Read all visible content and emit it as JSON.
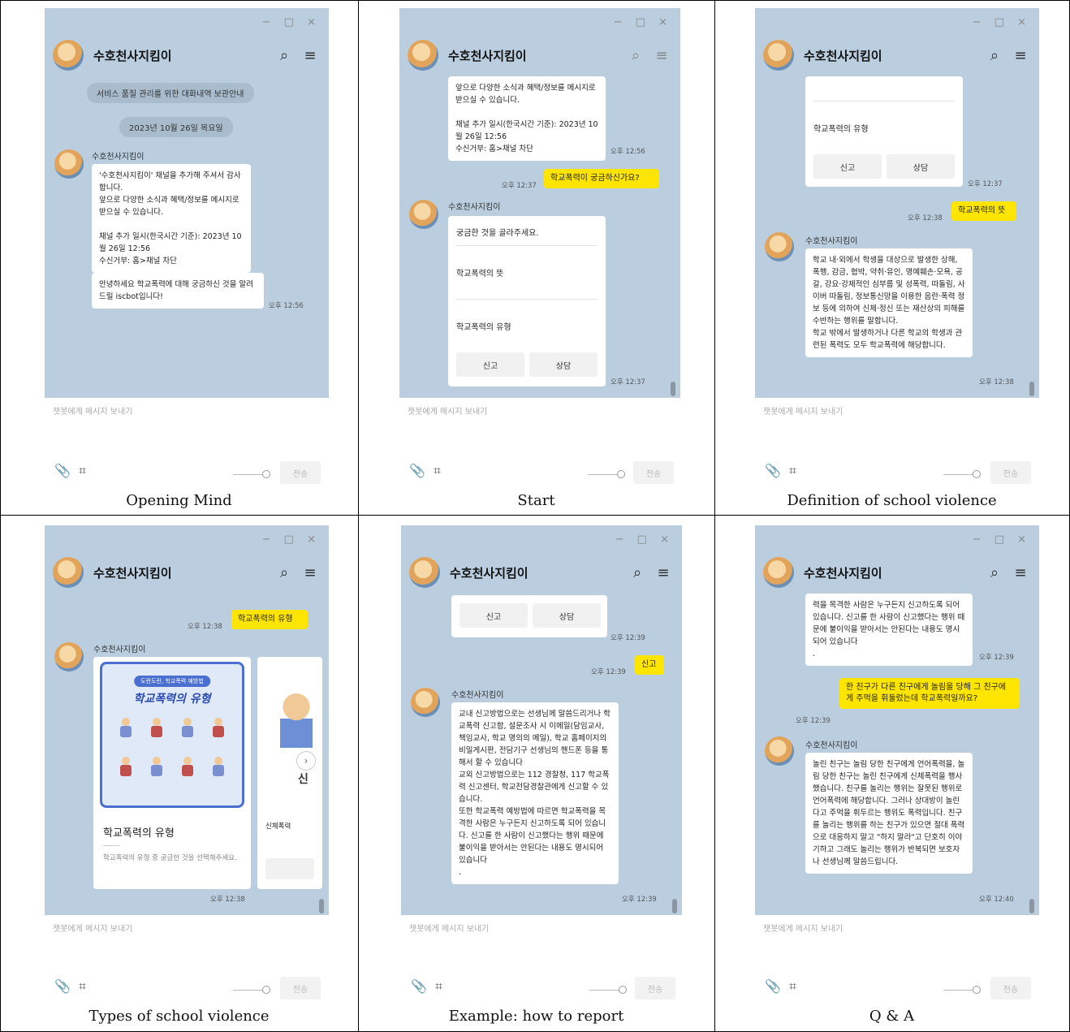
{
  "window": {
    "controls": "− □ ×",
    "bot_name": "수호천사지킴이",
    "input_placeholder": "챗봇에게 메시지 보내기",
    "send_label": "전송"
  },
  "colors": {
    "chat_bg": "#bacee0",
    "user_bubble": "#fee500",
    "bot_bubble": "#ffffff"
  },
  "captions": [
    "Opening Mind",
    "Start",
    "Definition of school violence",
    "Types of school violence",
    "Example: how to report",
    "Q & A"
  ],
  "panel1": {
    "notice": "서비스 품질 관리를 위한 대화내역 보관안내",
    "date": "2023년 10월 26일 목요일",
    "sender": "수호천사지킴이",
    "msg1": "'수호천사지킴이' 채널을 추가해 주셔서 감사합니다.\n앞으로 다양한 소식과 혜택/정보를 메시지로 받으실 수 있습니다.\n\n채널 추가 일시(한국시간 기준): 2023년 10월 26일 12:56\n수신거부: 홈>채널 차단",
    "msg2": "안녕하세요 학교폭력에 대해 궁금하신 것을 알려드릴 iscbot입니다!",
    "time": "오후 12:56"
  },
  "panel2": {
    "msg_top": "앞으로 다양한 소식과 혜택/정보를 메시지로 받으실 수 있습니다.\n\n채널 추가 일시(한국시간 기준): 2023년 10월 26일 12:56\n수신거부: 홈>채널 차단",
    "time1": "오후 12:56",
    "user_msg": "학교폭력이 궁금하신가요?",
    "time2": "오후 12:37",
    "sender": "수호천사지킴이",
    "card_header": "궁금한 것을 골라주세요.",
    "item1": "학교폭력의 뜻",
    "item2": "학교폭력의 유형",
    "btn_report": "신고",
    "btn_counsel": "상담",
    "time3": "오후 12:37"
  },
  "panel3": {
    "item": "학교폭력의 유형",
    "btn_report": "신고",
    "btn_counsel": "상담",
    "time1": "오후 12:37",
    "user_msg": "학교폭력의 뜻",
    "time2": "오후 12:38",
    "sender": "수호천사지킴이",
    "answer": "학교 내·외에서 학생을 대상으로 발생한 상해, 폭행, 감금, 협박, 약취·유인, 명예훼손·모욕, 공갈, 강요·강제적인 심부름 및 성폭력, 따돌림, 사이버 따돌림, 정보통신망을 이용한 음란·폭력 정보 등에 의하여 신체·정신 또는 재산상의 피해를 수반하는 행위를 말합니다.\n학교 밖에서 발생하거나 다른 학교의 학생과 관련된 폭력도 모두 학교폭력에 해당합니다.",
    "time3": "오후 12:38"
  },
  "panel4": {
    "time1": "오후 12:38",
    "user_msg": "학교폭력의 유형",
    "sender": "수호천사지킴이",
    "poster_chip": "도란도란, 학교폭력 예방법",
    "poster_title": "학교폭력의 유형",
    "card_title": "학교폭력의 유형",
    "card_desc": "학교폭력의 유형 중 궁금한 것을 선택해주세요.",
    "next_card_label": "신체폭력",
    "next_card_char": "신",
    "time2": "오후 12:38"
  },
  "panel5": {
    "btn_report": "신고",
    "btn_counsel": "상담",
    "time1": "오후 12:39",
    "user_msg": "신고",
    "time2": "오후 12:39",
    "sender": "수호천사지킴이",
    "answer": "교내 신고방법으로는 선생님께 말씀드리거나 학교폭력 신고함, 설문조사 시 이메일(담임교사, 책임교사, 학교 명의의 메일), 학교 홈페이지의 비밀게시판, 전담기구 선생님의 핸드폰 등을 통해서 할 수 있습니다\n교외 신고방법으로는 112 경찰청, 117 학교폭력 신고센터, 학교전담경찰관에게 신고할 수 있습니다.\n또한 학교폭력 예방법에 따르면 학교폭력을 목격한 사람은 누구든지 신고하도록 되어 있습니다. 신고를 한 사람이 신고했다는 행위 때문에 불이익을 받아서는 안된다는 내용도 명시되어 있습니다\n.",
    "time3": "오후 12:39"
  },
  "panel6": {
    "msg_top": "력을 목격한 사람은 누구든지 신고하도록 되어 있습니다. 신고를 한 사람이 신고했다는 행위 때문에 불이익을 받아서는 안된다는 내용도 명시되어 있습니다\n.",
    "time1": "오후 12:39",
    "user_msg": "한 친구가 다른 친구에게 놀림을 당해 그 친구에게 주먹을 휘둘렀는데 학교폭력일까요?",
    "time2": "오후 12:39",
    "sender": "수호천사지킴이",
    "answer": "놀린 친구는 놀림 당한 친구에게 언어폭력을, 놀림 당한 친구는 놀린 친구에게 신체폭력을 행사했습니다. 친구를 놀리는 행위는 잘못된 행위로 언어폭력에 해당합니다. 그러나 상대방이 놀린다고 주먹을 휘두르는 행위도 폭력입니다. 친구를 놀리는 행위를 하는 친구가 있으면 절대 폭력으로 대응하지 말고 \"하지 말라\"고 단호히 이야기하고 그래도 놀리는 행위가 반복되면 보호자나 선생님께 말씀드립니다.",
    "time3": "오후 12:40"
  }
}
